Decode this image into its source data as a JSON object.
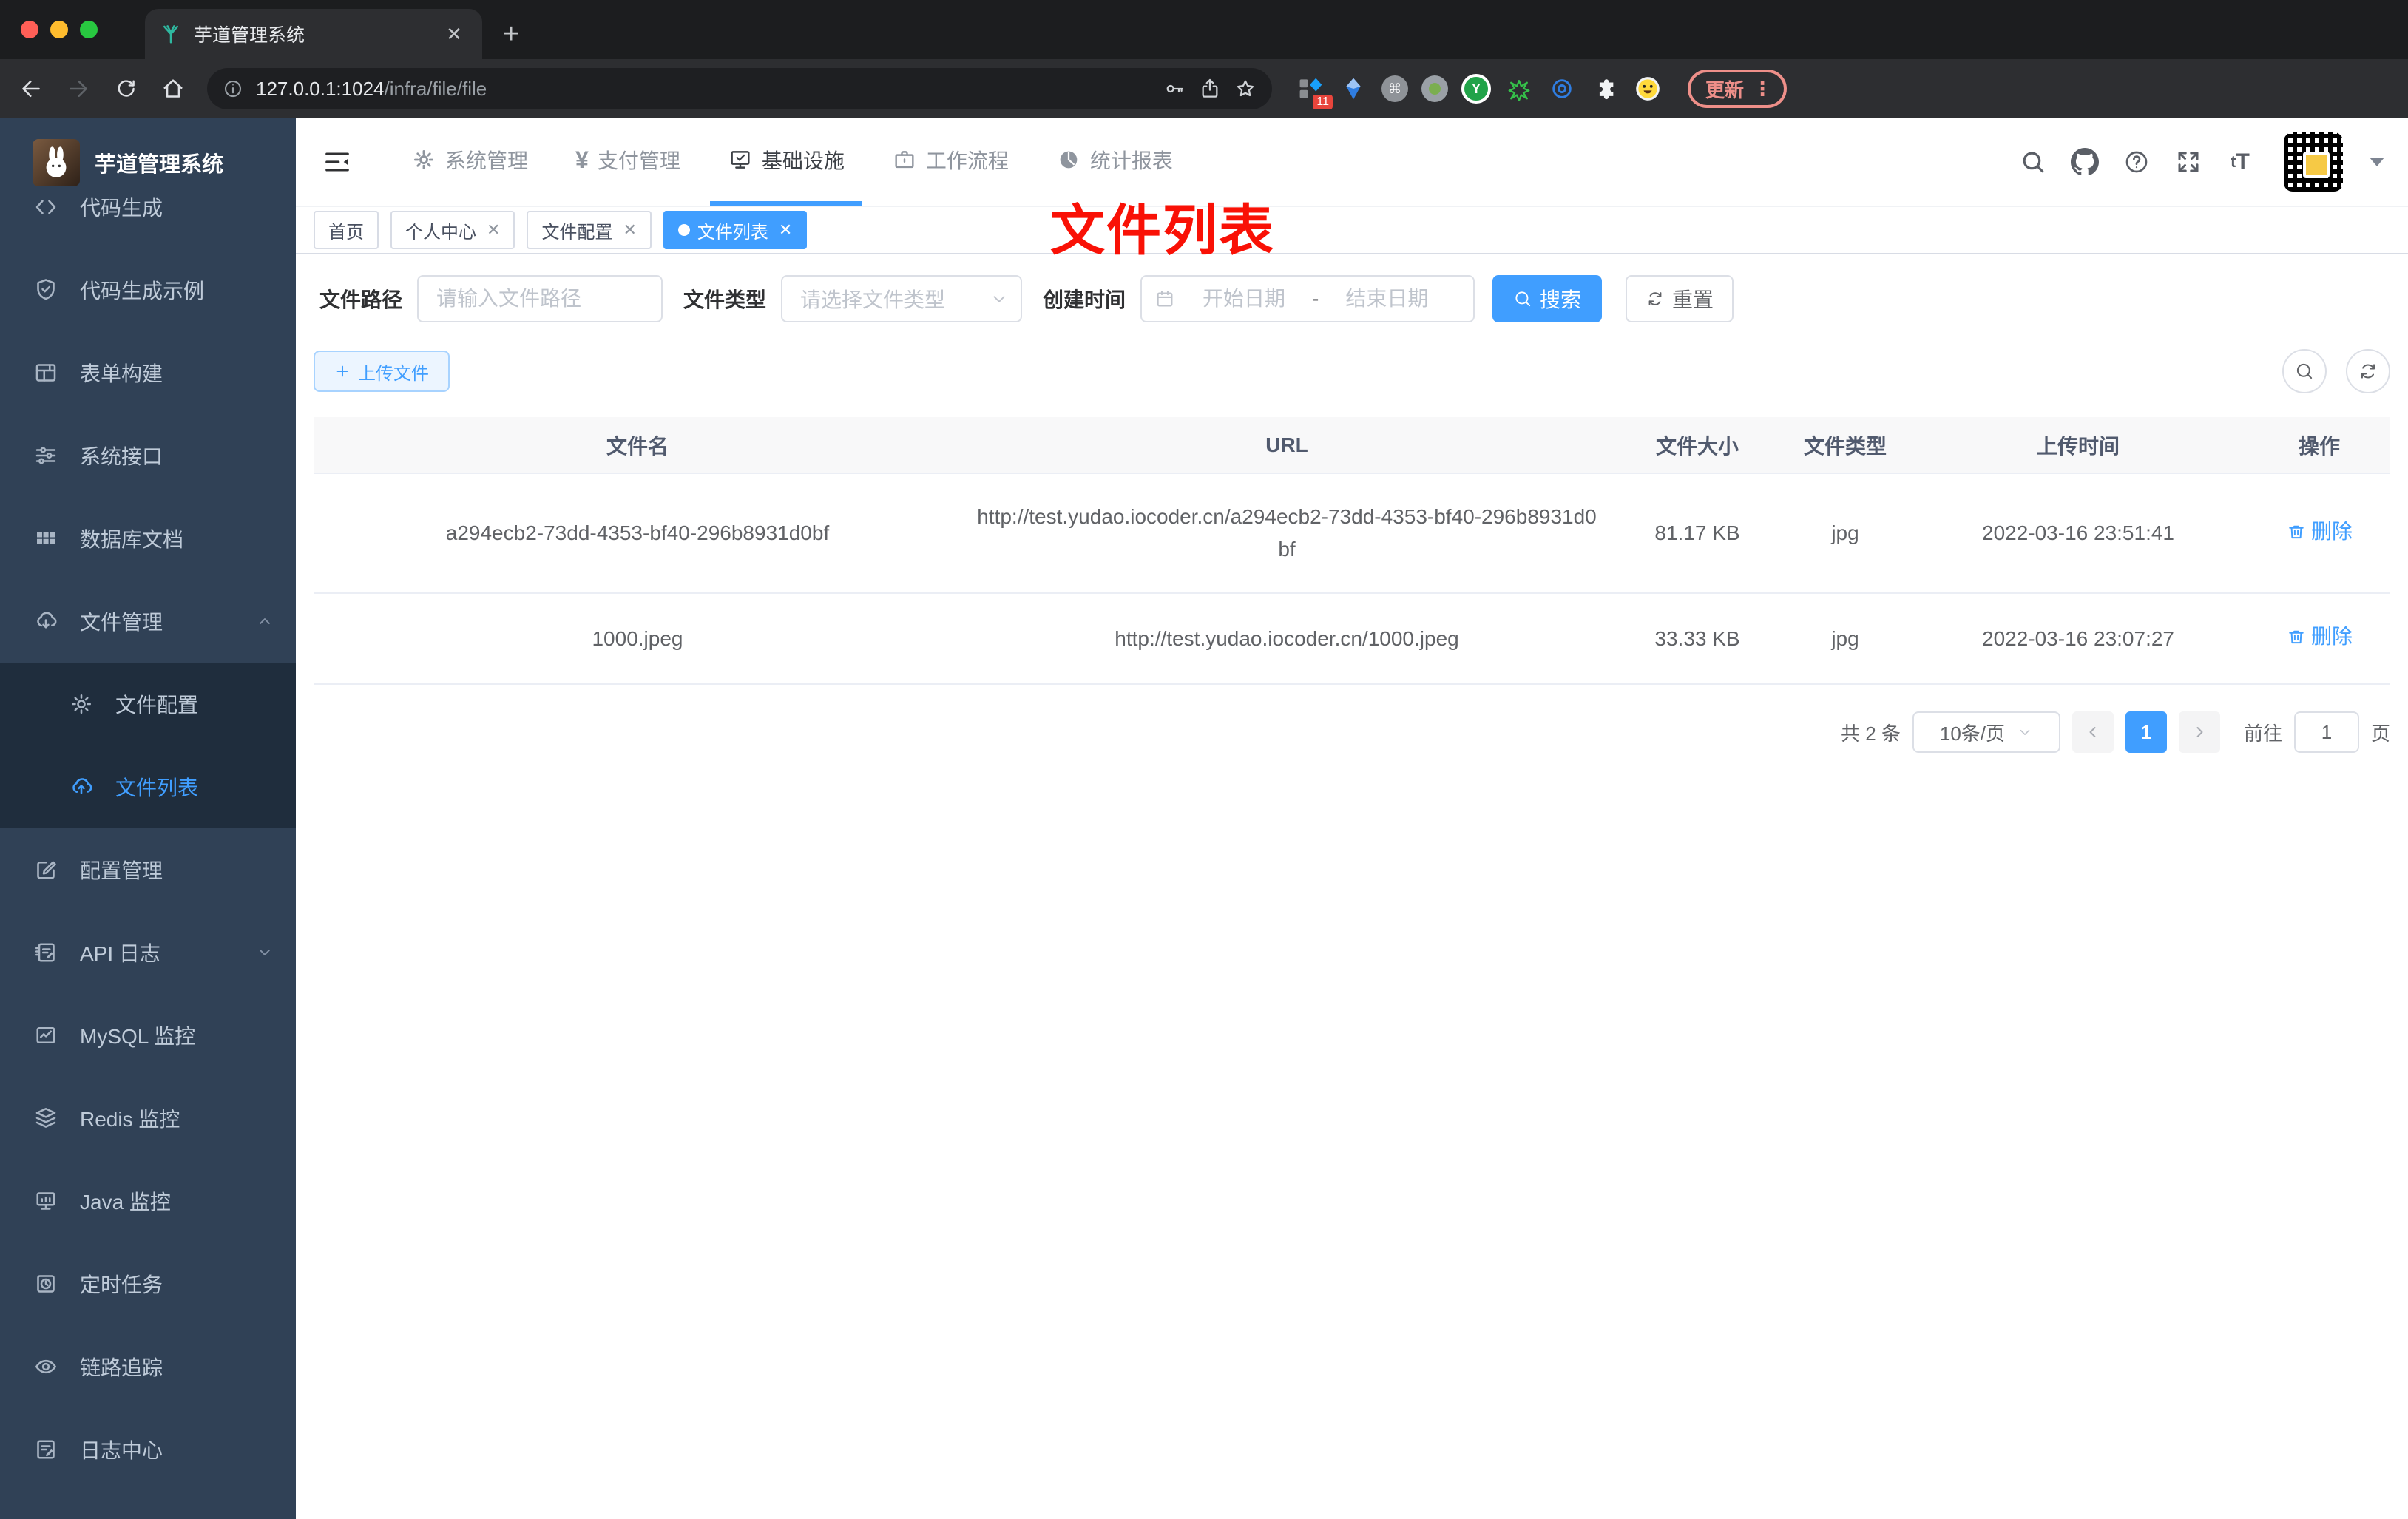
{
  "browser": {
    "tab_title": "芋道管理系统",
    "new_tab": "+",
    "close_tab": "✕",
    "url_host": "127.0.0.1:1024",
    "url_path": "/infra/file/file",
    "ext_badge": "11",
    "ext_cmd": "⌘",
    "ext_y": "Y",
    "update_label": "更新",
    "update_dots": "⋮"
  },
  "sidebar": {
    "title": "芋道管理系统",
    "items": [
      {
        "icon": "code-icon",
        "label": "代码生成"
      },
      {
        "icon": "shield-check-icon",
        "label": "代码生成示例"
      },
      {
        "icon": "form-icon",
        "label": "表单构建"
      },
      {
        "icon": "sliders-icon",
        "label": "系统接口"
      },
      {
        "icon": "database-grid-icon",
        "label": "数据库文档"
      },
      {
        "icon": "cloud-download-icon",
        "label": "文件管理",
        "expanded": true
      },
      {
        "icon": "gear-icon",
        "label": "文件配置",
        "sub": true
      },
      {
        "icon": "cloud-upload-icon",
        "label": "文件列表",
        "sub": true,
        "active": true
      },
      {
        "icon": "edit-square-icon",
        "label": "配置管理"
      },
      {
        "icon": "doc-edit-icon",
        "label": "API 日志",
        "collapsed": true
      },
      {
        "icon": "chart-box-icon",
        "label": "MySQL 监控"
      },
      {
        "icon": "layers-icon",
        "label": "Redis 监控"
      },
      {
        "icon": "monitor-icon",
        "label": "Java 监控"
      },
      {
        "icon": "timer-icon",
        "label": "定时任务"
      },
      {
        "icon": "eye-icon",
        "label": "链路追踪"
      },
      {
        "icon": "log-center-icon",
        "label": "日志中心"
      }
    ]
  },
  "navbar": {
    "items": [
      {
        "icon": "gear-icon",
        "label": "系统管理"
      },
      {
        "icon": "yen-icon",
        "label": "支付管理",
        "glyph": "¥"
      },
      {
        "icon": "infra-monitor-icon",
        "label": "基础设施",
        "active": true
      },
      {
        "icon": "briefcase-icon",
        "label": "工作流程"
      },
      {
        "icon": "pie-chart-icon",
        "label": "统计报表"
      }
    ],
    "font_size_icon": "tT"
  },
  "tags": [
    {
      "label": "首页",
      "closable": false,
      "active": false
    },
    {
      "label": "个人中心",
      "closable": true,
      "active": false
    },
    {
      "label": "文件配置",
      "closable": true,
      "active": false
    },
    {
      "label": "文件列表",
      "closable": true,
      "active": true
    }
  ],
  "annotation": "文件列表",
  "filter": {
    "path_label": "文件路径",
    "path_placeholder": "请输入文件路径",
    "type_label": "文件类型",
    "type_placeholder": "请选择文件类型",
    "time_label": "创建时间",
    "start_placeholder": "开始日期",
    "range_separator": "-",
    "end_placeholder": "结束日期",
    "search_label": "搜索",
    "reset_label": "重置"
  },
  "toolbar": {
    "upload_label": "上传文件"
  },
  "table": {
    "columns": [
      "文件名",
      "URL",
      "文件大小",
      "文件类型",
      "上传时间",
      "操作"
    ],
    "rows": [
      {
        "name": "a294ecb2-73dd-4353-bf40-296b8931d0bf",
        "url": "http://test.yudao.iocoder.cn/a294ecb2-73dd-4353-bf40-296b8931d0bf",
        "size": "81.17 KB",
        "type": "jpg",
        "time": "2022-03-16 23:51:41",
        "action": "删除"
      },
      {
        "name": "1000.jpeg",
        "url": "http://test.yudao.iocoder.cn/1000.jpeg",
        "size": "33.33 KB",
        "type": "jpg",
        "time": "2022-03-16 23:07:27",
        "action": "删除"
      }
    ]
  },
  "pagination": {
    "total_text": "共 2 条",
    "page_size": "10条/页",
    "current_page": "1",
    "goto_label": "前往",
    "goto_value": "1",
    "page_unit": "页"
  },
  "colors": {
    "accent": "#409eff",
    "annotation_red": "#f91106",
    "sidebar_bg": "#304156",
    "submenu_bg": "#1f2d3d",
    "chrome_dark": "#2d2e31"
  }
}
